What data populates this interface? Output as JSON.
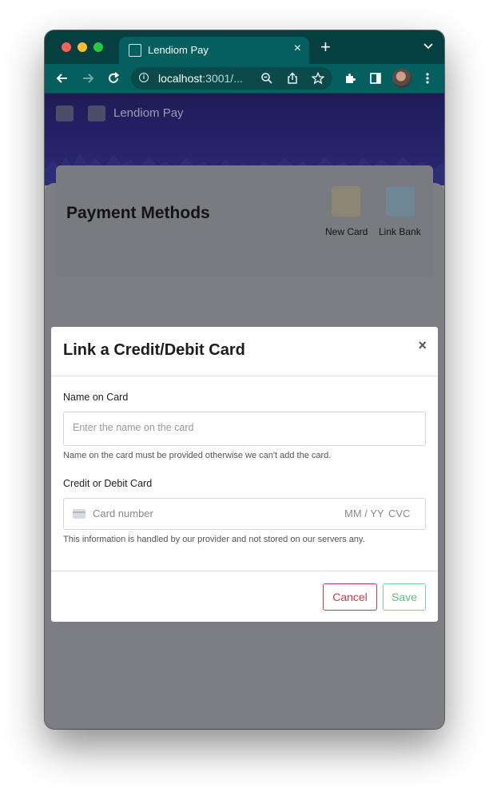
{
  "browser": {
    "tab_title": "Lendiom Pay",
    "new_tab_symbol": "+",
    "close_symbol": "×",
    "url_host": "localhost",
    "url_rest": ":3001/..."
  },
  "page": {
    "brand": "Lendiom Pay",
    "title": "Payment Methods",
    "actions": [
      {
        "label": "New Card",
        "color": "#e8a25a"
      },
      {
        "label": "Link Bank",
        "color": "#3a8fd0"
      }
    ]
  },
  "modal": {
    "title": "Link a Credit/Debit Card",
    "close_symbol": "×",
    "name_label": "Name on Card",
    "name_placeholder": "Enter the name on the card",
    "name_help": "Name on the card must be provided otherwise we can't add the card.",
    "card_label": "Credit or Debit Card",
    "card_number_placeholder": "Card number",
    "card_expiry_placeholder": "MM / YY",
    "card_cvc_placeholder": "CVC",
    "card_help": "This information is handled by our provider and not stored on our servers any.",
    "cancel_label": "Cancel",
    "save_label": "Save"
  },
  "colors": {
    "chrome": "#065f5f",
    "cancel": "#d9364a",
    "save": "#5fbf7d",
    "hero": "#25236a"
  }
}
